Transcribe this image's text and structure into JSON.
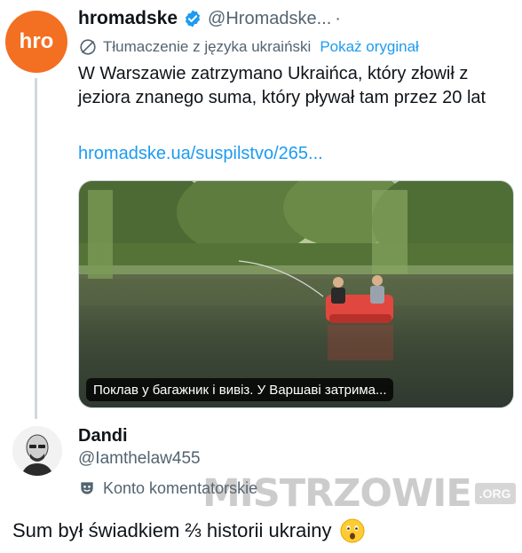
{
  "tweet": {
    "avatar_text": "hro",
    "display_name": "hromadske",
    "handle": "@Hromadske...",
    "separator": "·",
    "translation_note": "Tłumaczenie z języka ukraiński",
    "show_original": "Pokaż oryginał",
    "text": "W Warszawie zatrzymano Ukraińca, który złowił z jeziora znanego suma, który pływał tam przez 20 lat",
    "link": "hromadske.ua/suspilstvo/265...",
    "media_caption": "Поклав у багажник і вивіз. У Варшаві затрима..."
  },
  "reply": {
    "display_name": "Dandi",
    "handle": "@Iamthelaw455",
    "account_type": "Konto komentatorskie",
    "text": "Sum był świadkiem ⅔ historii ukrainy",
    "emoji": "astonished-face"
  },
  "watermark": {
    "text": "MISTRZOWIE",
    "suffix": ".ORG"
  },
  "colors": {
    "link_blue": "#1d9bf0",
    "secondary_text": "#536471",
    "hromadske_orange": "#f36f21",
    "verified_blue": "#1d9bf0"
  }
}
